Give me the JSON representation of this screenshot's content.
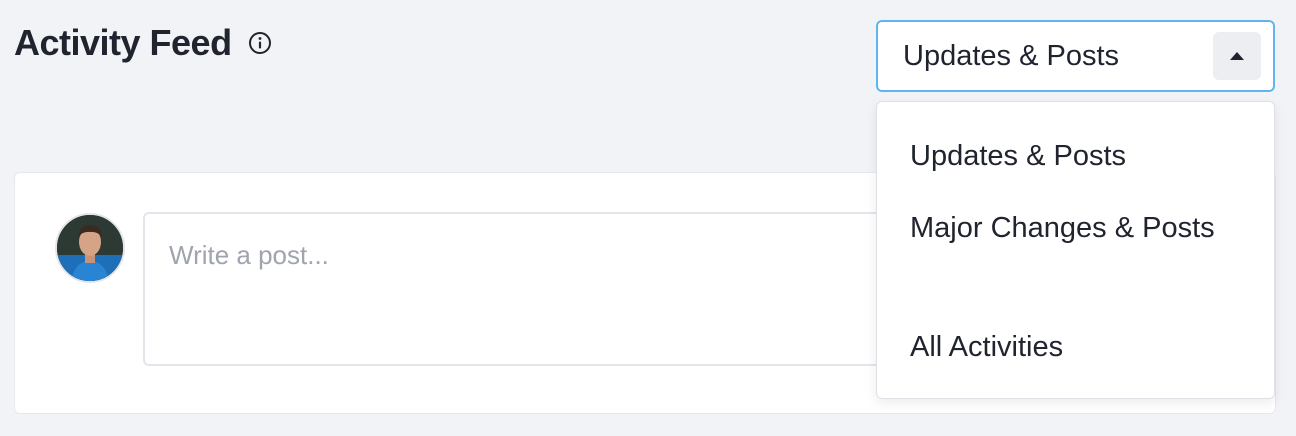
{
  "header": {
    "title": "Activity Feed",
    "info_icon": "info-circle-icon"
  },
  "filter": {
    "selected": "Updates & Posts",
    "toggle_icon": "caret-up-icon",
    "options": [
      "Updates & Posts",
      "Major Changes & Posts",
      "All Activities"
    ]
  },
  "composer": {
    "avatar_icon": "user-avatar",
    "placeholder": "Write a post..."
  },
  "colors": {
    "background": "#f2f3f7",
    "accent_border": "#5eb6ec",
    "placeholder_text": "#a0a4ae"
  }
}
